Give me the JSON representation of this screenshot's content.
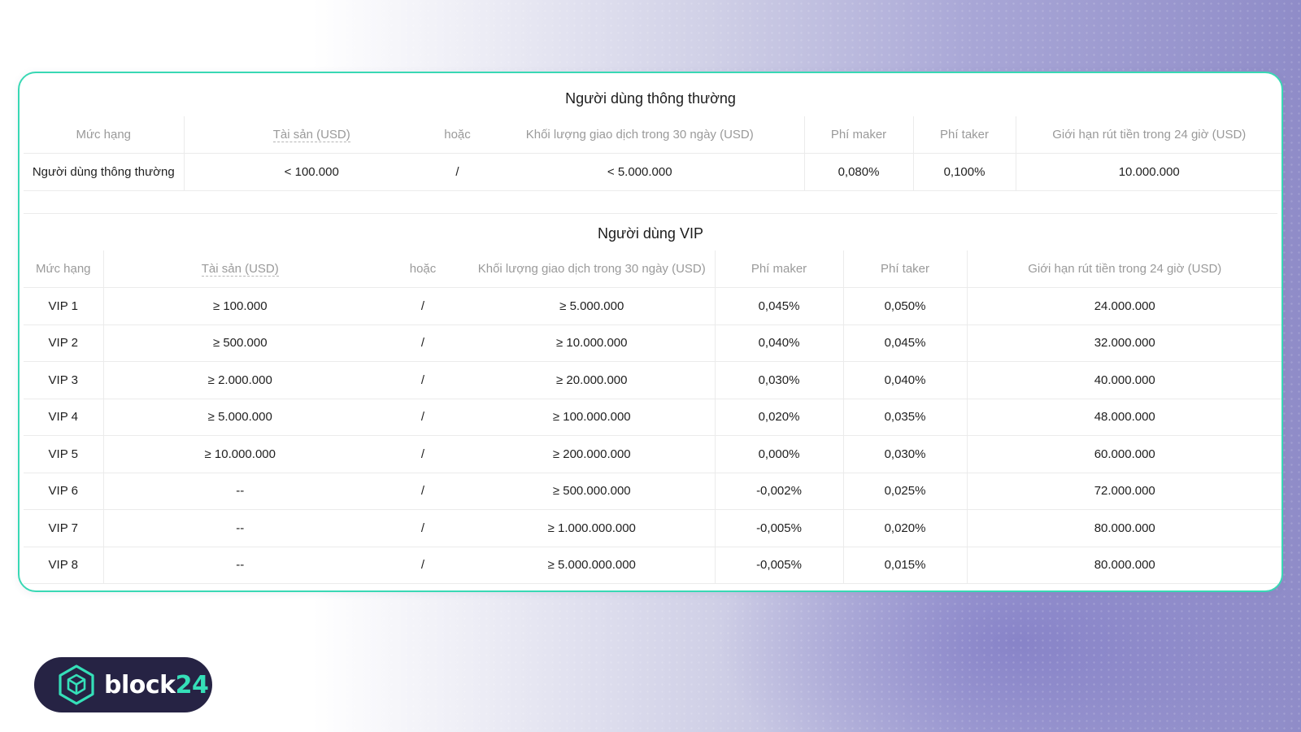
{
  "normal": {
    "title": "Người dùng thông thường",
    "headers": {
      "tier": "Mức hạng",
      "assets": "Tài sản (USD)",
      "or": "hoặc",
      "volume": "Khối lượng giao dịch trong 30 ngày (USD)",
      "maker": "Phí maker",
      "taker": "Phí taker",
      "withdraw": "Giới hạn rút tiền trong 24 giờ (USD)"
    },
    "row": {
      "tier": "Người dùng thông thường",
      "assets": "< 100.000",
      "or": "/",
      "volume": "< 5.000.000",
      "maker": "0,080%",
      "taker": "0,100%",
      "withdraw": "10.000.000"
    }
  },
  "vip": {
    "title": "Người dùng VIP",
    "headers": {
      "tier": "Mức hạng",
      "assets": "Tài sản (USD)",
      "or": "hoặc",
      "volume": "Khối lượng giao dịch trong 30 ngày (USD)",
      "maker": "Phí maker",
      "taker": "Phí taker",
      "withdraw": "Giới hạn rút tiền trong 24 giờ (USD)"
    },
    "rows": [
      {
        "tier": "VIP 1",
        "assets": "≥ 100.000",
        "or": "/",
        "volume": "≥ 5.000.000",
        "maker": "0,045%",
        "taker": "0,050%",
        "withdraw": "24.000.000"
      },
      {
        "tier": "VIP 2",
        "assets": "≥ 500.000",
        "or": "/",
        "volume": "≥ 10.000.000",
        "maker": "0,040%",
        "taker": "0,045%",
        "withdraw": "32.000.000"
      },
      {
        "tier": "VIP 3",
        "assets": "≥ 2.000.000",
        "or": "/",
        "volume": "≥ 20.000.000",
        "maker": "0,030%",
        "taker": "0,040%",
        "withdraw": "40.000.000"
      },
      {
        "tier": "VIP 4",
        "assets": "≥ 5.000.000",
        "or": "/",
        "volume": "≥ 100.000.000",
        "maker": "0,020%",
        "taker": "0,035%",
        "withdraw": "48.000.000"
      },
      {
        "tier": "VIP 5",
        "assets": "≥ 10.000.000",
        "or": "/",
        "volume": "≥ 200.000.000",
        "maker": "0,000%",
        "taker": "0,030%",
        "withdraw": "60.000.000"
      },
      {
        "tier": "VIP 6",
        "assets": "--",
        "or": "/",
        "volume": "≥ 500.000.000",
        "maker": "-0,002%",
        "taker": "0,025%",
        "withdraw": "72.000.000"
      },
      {
        "tier": "VIP 7",
        "assets": "--",
        "or": "/",
        "volume": "≥ 1.000.000.000",
        "maker": "-0,005%",
        "taker": "0,020%",
        "withdraw": "80.000.000"
      },
      {
        "tier": "VIP 8",
        "assets": "--",
        "or": "/",
        "volume": "≥ 5.000.000.000",
        "maker": "-0,005%",
        "taker": "0,015%",
        "withdraw": "80.000.000"
      }
    ]
  },
  "logo": {
    "text_main": "block",
    "text_accent": "24",
    "icon": "hexagon-cube-icon",
    "accent_color": "#35dfb8"
  }
}
